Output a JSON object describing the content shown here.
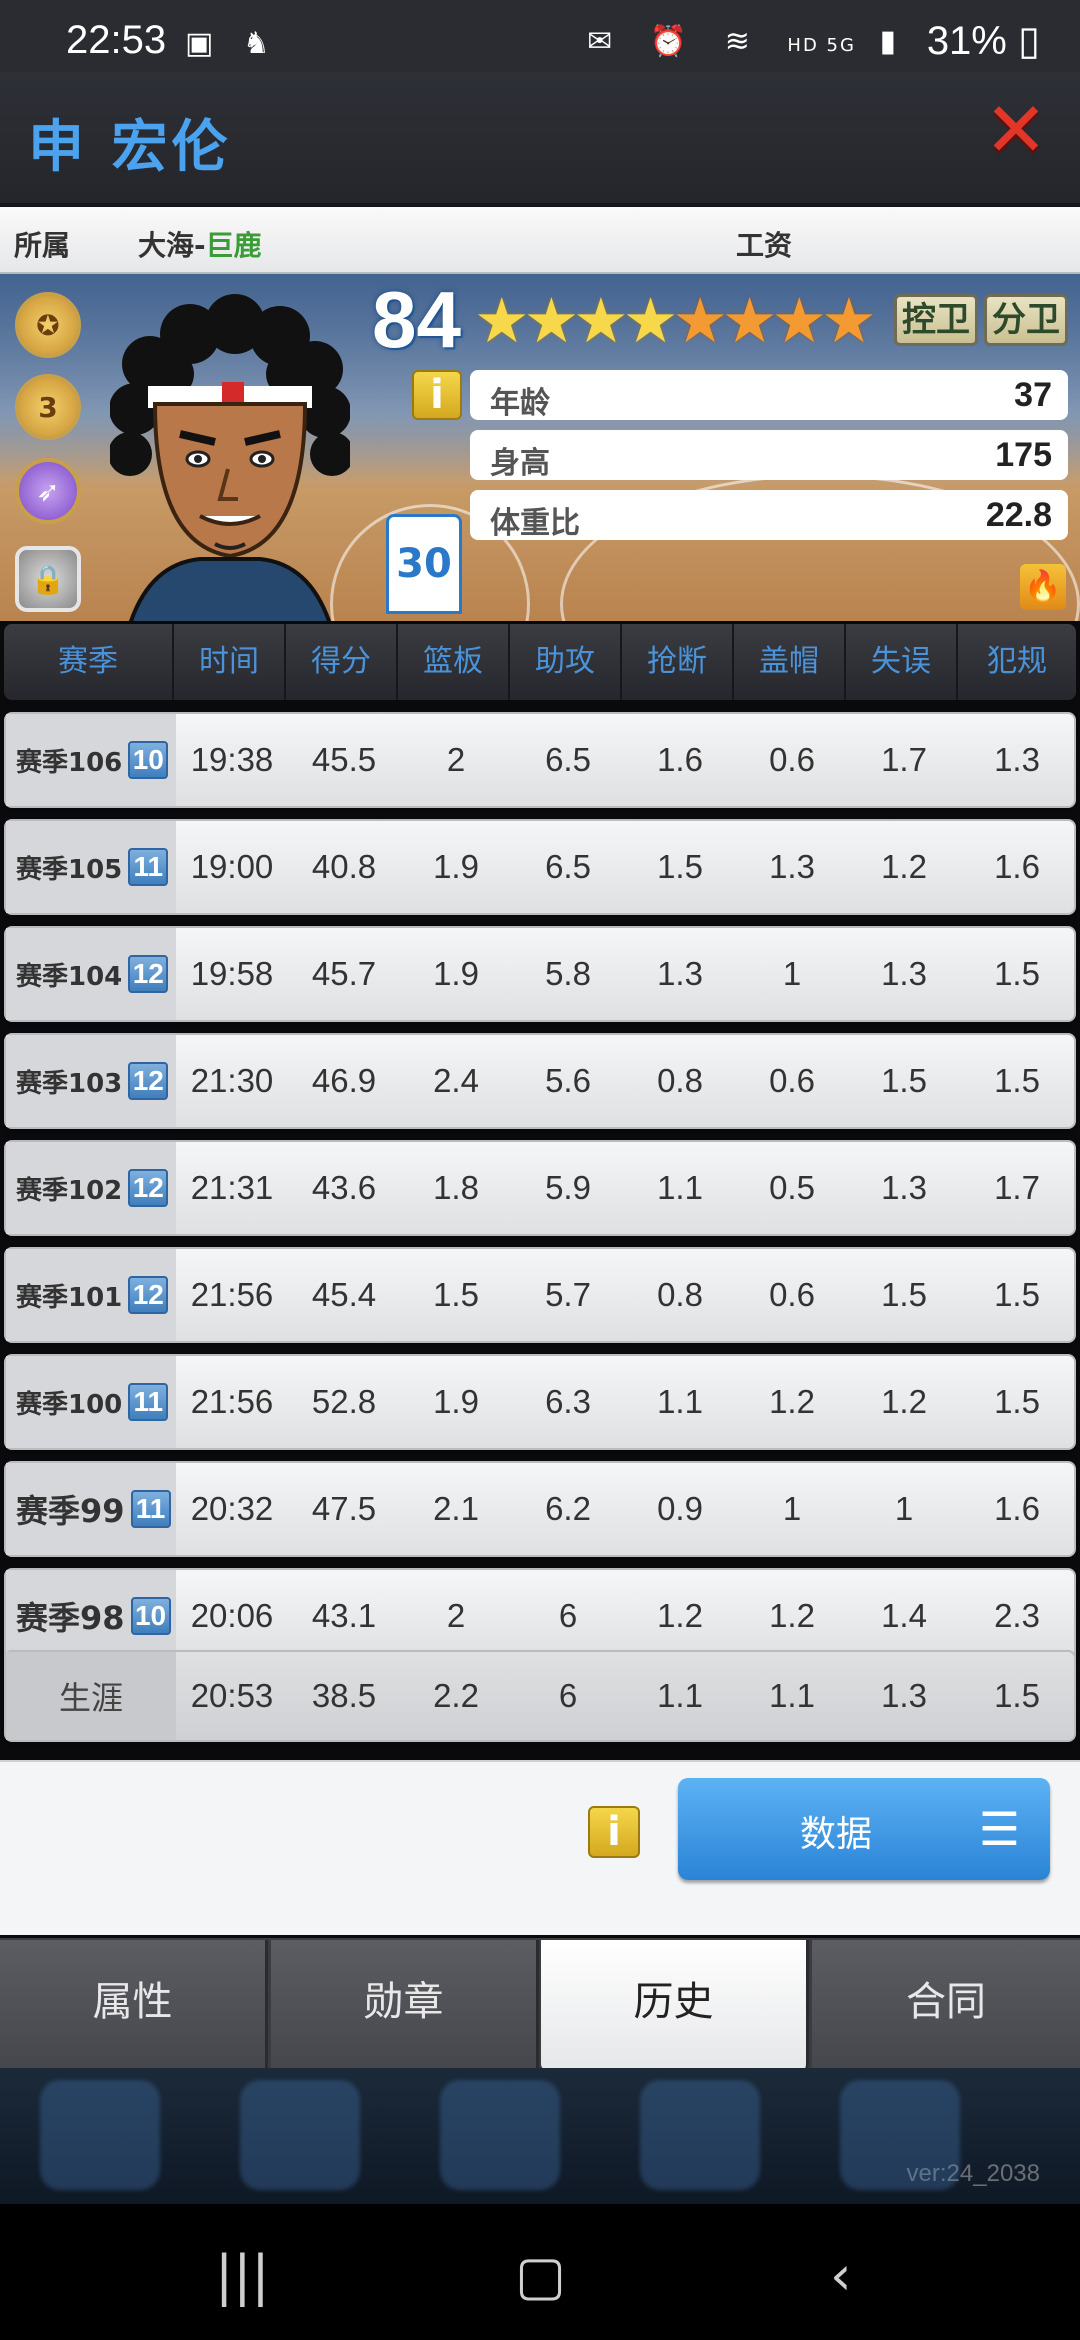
{
  "status_bar": {
    "time": "22:53",
    "network": "HD 5G",
    "battery": "31%"
  },
  "header": {
    "player_name": "申 宏伦",
    "close_icon": "close-x-icon"
  },
  "team_row": {
    "team_label": "所属",
    "team_prefix": "大海-",
    "team_name": "巨鹿",
    "salary_label": "工资"
  },
  "player": {
    "rating": "84",
    "stars_gold": 4,
    "stars_orange": 4,
    "jersey_number": "30",
    "positions": [
      "控卫",
      "分卫"
    ],
    "attributes": [
      {
        "label": "年龄",
        "value": "37"
      },
      {
        "label": "身高",
        "value": "175"
      },
      {
        "label": "体重比",
        "value": "22.8"
      }
    ],
    "badge_level": "3"
  },
  "table": {
    "headers": [
      "赛季",
      "时间",
      "得分",
      "篮板",
      "助攻",
      "抢断",
      "盖帽",
      "失误",
      "犯规"
    ],
    "rows": [
      {
        "season": "赛季106",
        "level": "10",
        "values": [
          "19:38",
          "45.5",
          "2",
          "6.5",
          "1.6",
          "0.6",
          "1.7",
          "1.3"
        ]
      },
      {
        "season": "赛季105",
        "level": "11",
        "values": [
          "19:00",
          "40.8",
          "1.9",
          "6.5",
          "1.5",
          "1.3",
          "1.2",
          "1.6"
        ]
      },
      {
        "season": "赛季104",
        "level": "12",
        "values": [
          "19:58",
          "45.7",
          "1.9",
          "5.8",
          "1.3",
          "1",
          "1.3",
          "1.5"
        ]
      },
      {
        "season": "赛季103",
        "level": "12",
        "values": [
          "21:30",
          "46.9",
          "2.4",
          "5.6",
          "0.8",
          "0.6",
          "1.5",
          "1.5"
        ]
      },
      {
        "season": "赛季102",
        "level": "12",
        "values": [
          "21:31",
          "43.6",
          "1.8",
          "5.9",
          "1.1",
          "0.5",
          "1.3",
          "1.7"
        ]
      },
      {
        "season": "赛季101",
        "level": "12",
        "values": [
          "21:56",
          "45.4",
          "1.5",
          "5.7",
          "0.8",
          "0.6",
          "1.5",
          "1.5"
        ]
      },
      {
        "season": "赛季100",
        "level": "11",
        "values": [
          "21:56",
          "52.8",
          "1.9",
          "6.3",
          "1.1",
          "1.2",
          "1.2",
          "1.5"
        ]
      },
      {
        "season": "赛季99",
        "level": "11",
        "values": [
          "20:32",
          "47.5",
          "2.1",
          "6.2",
          "0.9",
          "1",
          "1",
          "1.6"
        ]
      },
      {
        "season": "赛季98",
        "level": "10",
        "values": [
          "20:06",
          "43.1",
          "2",
          "6",
          "1.2",
          "1.2",
          "1.4",
          "2.3"
        ]
      }
    ],
    "career": {
      "label": "生涯",
      "values": [
        "20:53",
        "38.5",
        "2.2",
        "6",
        "1.1",
        "1.1",
        "1.3",
        "1.5"
      ]
    }
  },
  "actions": {
    "data_button": "数据"
  },
  "tabs": [
    {
      "label": "属性",
      "active": false
    },
    {
      "label": "勋章",
      "active": false
    },
    {
      "label": "历史",
      "active": true
    },
    {
      "label": "合同",
      "active": false
    }
  ],
  "version": "ver:24_2038",
  "colors": {
    "accent_blue": "#4ba3ef",
    "close_red": "#e23629",
    "team_green": "#3a9c35",
    "level_badge": "#3f7fbd"
  }
}
